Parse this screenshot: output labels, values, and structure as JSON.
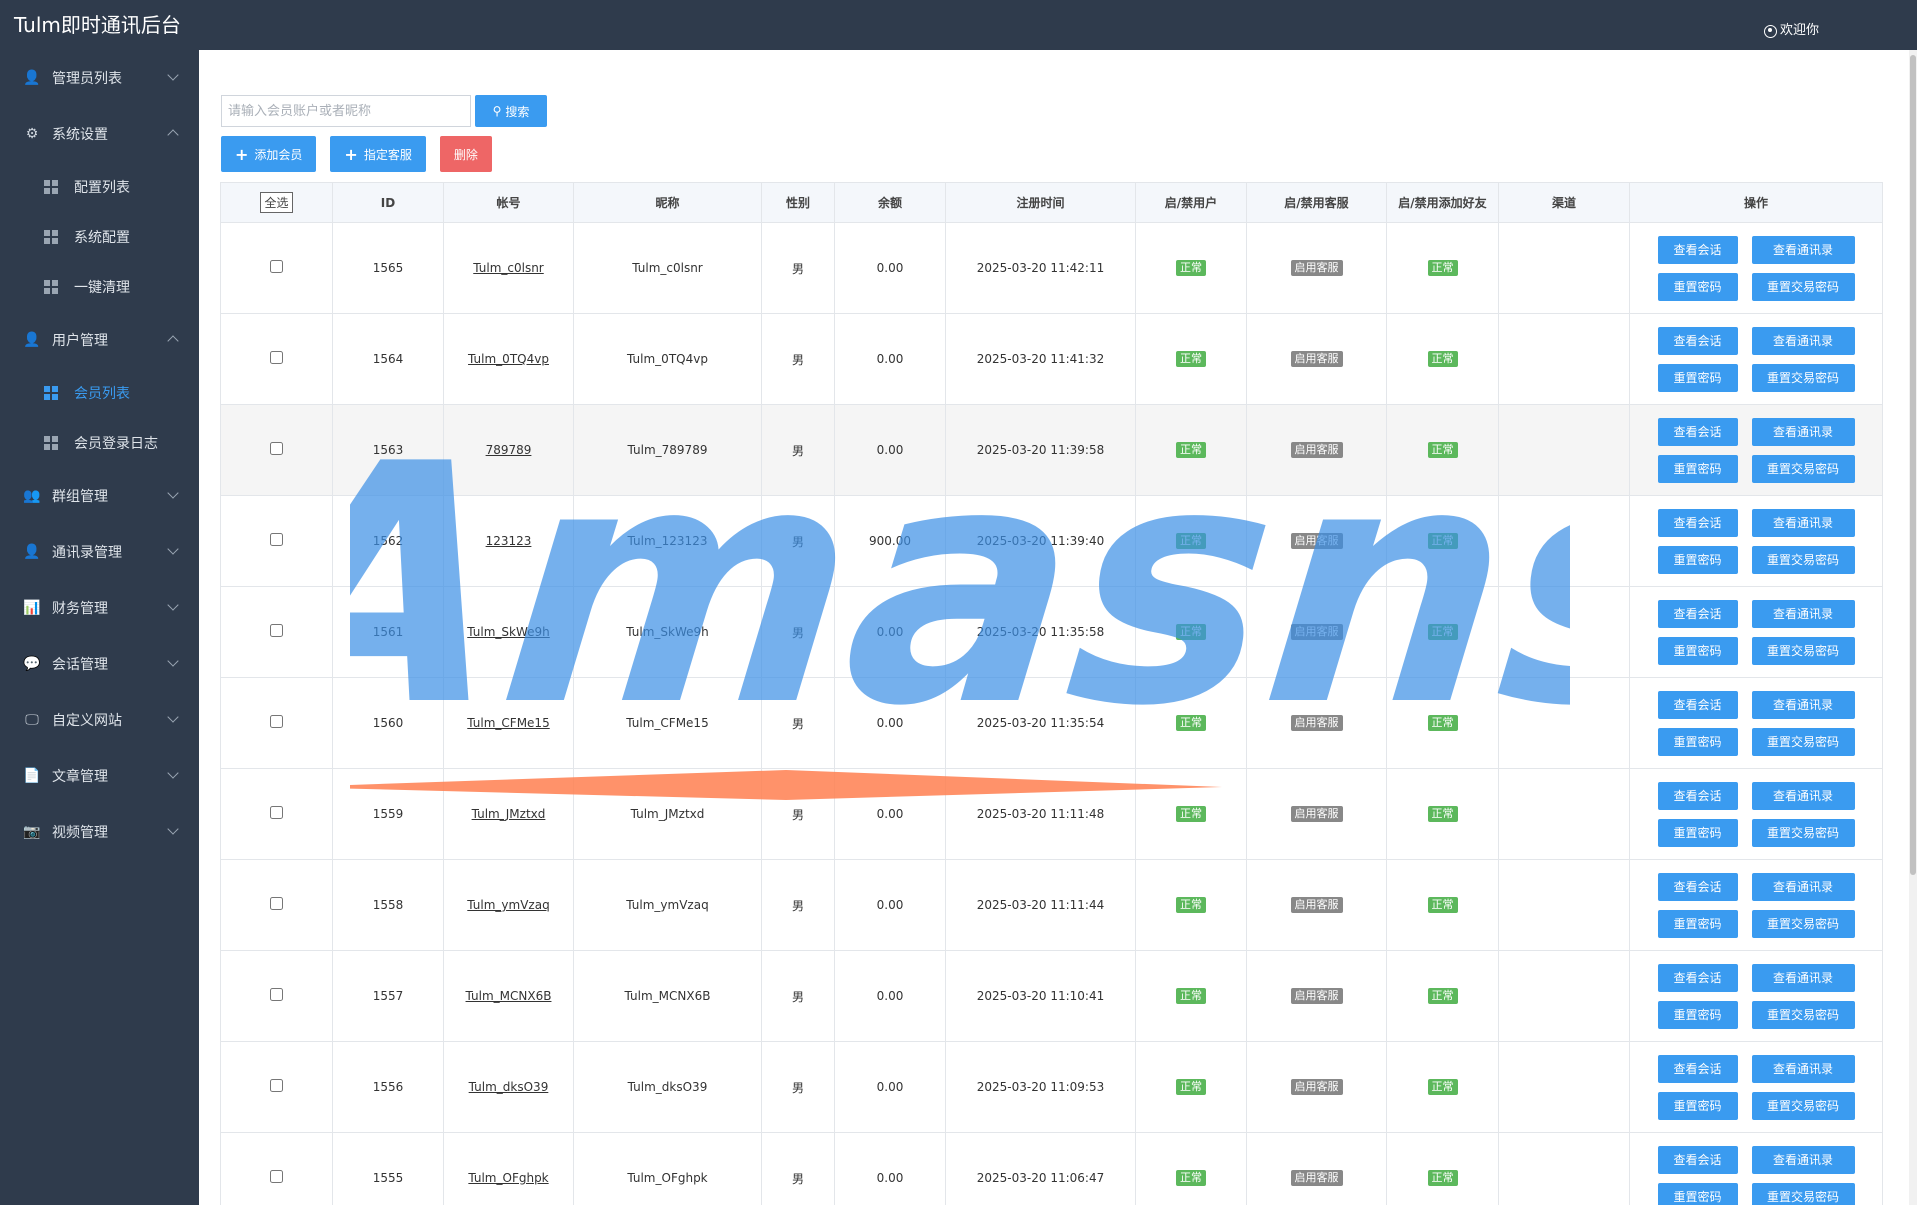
{
  "header": {
    "app_title": "Tulm即时通讯后台",
    "welcome_text": "欢迎你"
  },
  "sidebar": {
    "items": [
      {
        "label": "管理员列表",
        "icon": "user-icon",
        "expanded": false,
        "children": []
      },
      {
        "label": "系统设置",
        "icon": "gear-icon",
        "expanded": true,
        "children": [
          {
            "label": "配置列表",
            "active": false
          },
          {
            "label": "系统配置",
            "active": false
          },
          {
            "label": "一键清理",
            "active": false
          }
        ]
      },
      {
        "label": "用户管理",
        "icon": "user-icon",
        "expanded": true,
        "children": [
          {
            "label": "会员列表",
            "active": true
          },
          {
            "label": "会员登录日志",
            "active": false
          }
        ]
      },
      {
        "label": "群组管理",
        "icon": "group-icon",
        "expanded": false,
        "children": []
      },
      {
        "label": "通讯录管理",
        "icon": "user-icon",
        "expanded": false,
        "children": []
      },
      {
        "label": "财务管理",
        "icon": "chart-icon",
        "expanded": false,
        "children": []
      },
      {
        "label": "会话管理",
        "icon": "chat-icon",
        "expanded": false,
        "children": []
      },
      {
        "label": "自定义网站",
        "icon": "monitor-icon",
        "expanded": false,
        "children": []
      },
      {
        "label": "文章管理",
        "icon": "document-icon",
        "expanded": false,
        "children": []
      },
      {
        "label": "视频管理",
        "icon": "camera-icon",
        "expanded": false,
        "children": []
      }
    ]
  },
  "toolbar": {
    "search_placeholder": "请输入会员账户或者昵称",
    "search_label": "搜索",
    "add_member_label": "添加会员",
    "assign_service_label": "指定客服",
    "delete_label": "删除"
  },
  "table": {
    "columns": {
      "select_all": "全选",
      "id": "ID",
      "account": "帐号",
      "nickname": "昵称",
      "gender": "性别",
      "balance": "余额",
      "reg_time": "注册时间",
      "user_status": "启/禁用户",
      "service_status": "启/禁用客服",
      "friend_status": "启/禁用添加好友",
      "channel": "渠道",
      "actions": "操作"
    },
    "action_labels": {
      "view_chat": "查看会话",
      "view_contacts": "查看通讯录",
      "reset_password": "重置密码",
      "reset_trade_password": "重置交易密码"
    },
    "rows": [
      {
        "id": "1565",
        "account": "Tulm_c0lsnr",
        "nickname": "Tulm_c0lsnr",
        "gender": "男",
        "balance": "0.00",
        "reg_time": "2025-03-20 11:42:11",
        "user_status": "正常",
        "service_status": "启用客服",
        "friend_status": "正常",
        "channel": ""
      },
      {
        "id": "1564",
        "account": "Tulm_0TQ4vp",
        "nickname": "Tulm_0TQ4vp",
        "gender": "男",
        "balance": "0.00",
        "reg_time": "2025-03-20 11:41:32",
        "user_status": "正常",
        "service_status": "启用客服",
        "friend_status": "正常",
        "channel": ""
      },
      {
        "id": "1563",
        "account": "789789",
        "nickname": "Tulm_789789",
        "gender": "男",
        "balance": "0.00",
        "reg_time": "2025-03-20 11:39:58",
        "user_status": "正常",
        "service_status": "启用客服",
        "friend_status": "正常",
        "channel": ""
      },
      {
        "id": "1562",
        "account": "123123",
        "nickname": "Tulm_123123",
        "gender": "男",
        "balance": "900.00",
        "reg_time": "2025-03-20 11:39:40",
        "user_status": "正常",
        "service_status": "启用客服",
        "friend_status": "正常",
        "channel": ""
      },
      {
        "id": "1561",
        "account": "Tulm_SkWe9h",
        "nickname": "Tulm_SkWe9h",
        "gender": "男",
        "balance": "0.00",
        "reg_time": "2025-03-20 11:35:58",
        "user_status": "正常",
        "service_status": "启用客服",
        "friend_status": "正常",
        "channel": ""
      },
      {
        "id": "1560",
        "account": "Tulm_CFMe15",
        "nickname": "Tulm_CFMe15",
        "gender": "男",
        "balance": "0.00",
        "reg_time": "2025-03-20 11:35:54",
        "user_status": "正常",
        "service_status": "启用客服",
        "friend_status": "正常",
        "channel": ""
      },
      {
        "id": "1559",
        "account": "Tulm_JMztxd",
        "nickname": "Tulm_JMztxd",
        "gender": "男",
        "balance": "0.00",
        "reg_time": "2025-03-20 11:11:48",
        "user_status": "正常",
        "service_status": "启用客服",
        "friend_status": "正常",
        "channel": ""
      },
      {
        "id": "1558",
        "account": "Tulm_ymVzaq",
        "nickname": "Tulm_ymVzaq",
        "gender": "男",
        "balance": "0.00",
        "reg_time": "2025-03-20 11:11:44",
        "user_status": "正常",
        "service_status": "启用客服",
        "friend_status": "正常",
        "channel": ""
      },
      {
        "id": "1557",
        "account": "Tulm_MCNX6B",
        "nickname": "Tulm_MCNX6B",
        "gender": "男",
        "balance": "0.00",
        "reg_time": "2025-03-20 11:10:41",
        "user_status": "正常",
        "service_status": "启用客服",
        "friend_status": "正常",
        "channel": ""
      },
      {
        "id": "1556",
        "account": "Tulm_dksO39",
        "nickname": "Tulm_dksO39",
        "gender": "男",
        "balance": "0.00",
        "reg_time": "2025-03-20 11:09:53",
        "user_status": "正常",
        "service_status": "启用客服",
        "friend_status": "正常",
        "channel": ""
      },
      {
        "id": "1555",
        "account": "Tulm_OFghpk",
        "nickname": "Tulm_OFghpk",
        "gender": "男",
        "balance": "0.00",
        "reg_time": "2025-03-20 11:06:47",
        "user_status": "正常",
        "service_status": "启用客服",
        "friend_status": "正常",
        "channel": ""
      }
    ]
  },
  "watermark": {
    "text": "Amasns",
    "color": "#3a8ee6",
    "accent_color": "#ff7f50"
  },
  "colors": {
    "sidebar_bg": "#2f3b4c",
    "primary": "#3a9bf0",
    "danger": "#ee6666",
    "status_green": "#5cb85c",
    "status_gray": "#888888"
  }
}
